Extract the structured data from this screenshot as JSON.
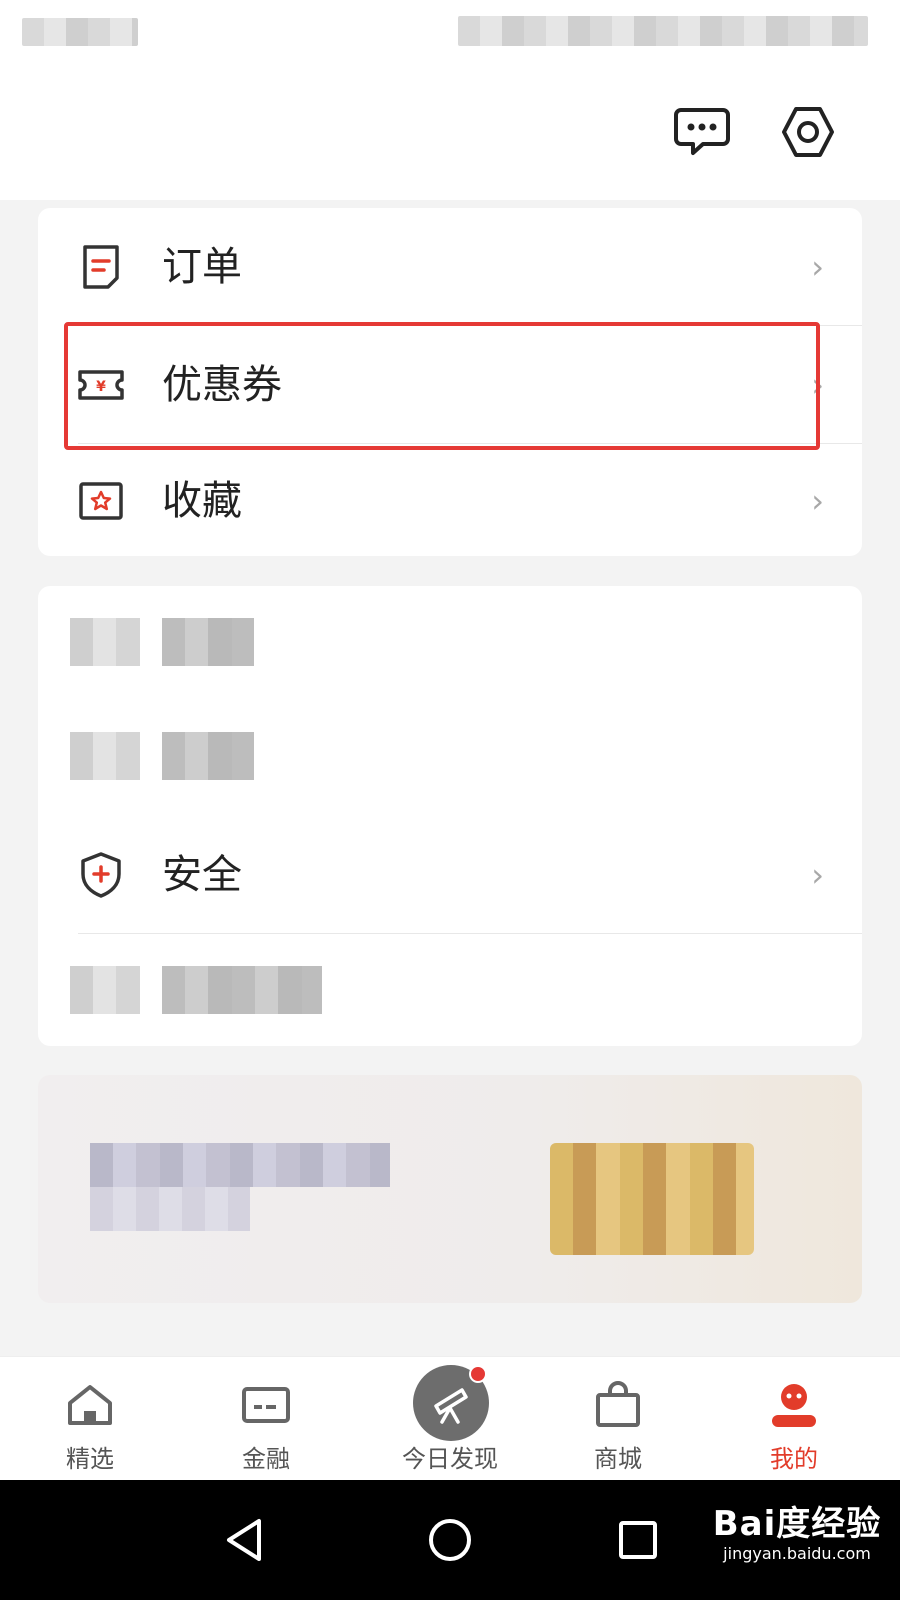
{
  "header": {
    "message_icon": "chat-bubble-icon",
    "settings_icon": "hexagon-gear-icon"
  },
  "menu_group_1": {
    "items": [
      {
        "label": "订单",
        "icon": "order-document-icon"
      },
      {
        "label": "优惠券",
        "icon": "coupon-ticket-icon",
        "currency_symbol": "¥"
      },
      {
        "label": "收藏",
        "icon": "favorite-star-icon"
      }
    ]
  },
  "menu_group_2": {
    "items": [
      {
        "label": "",
        "icon": "blurred-icon"
      },
      {
        "label": "",
        "icon": "blurred-icon"
      },
      {
        "label": "安全",
        "icon": "shield-plus-icon"
      },
      {
        "label": "",
        "icon": "blurred-icon"
      }
    ]
  },
  "chevron_glyph": "›",
  "tabbar": {
    "tabs": [
      {
        "label": "精选",
        "icon": "home-icon",
        "active": false
      },
      {
        "label": "金融",
        "icon": "card-icon",
        "active": false
      },
      {
        "label": "今日发现",
        "icon": "telescope-icon",
        "active": false,
        "badge": true
      },
      {
        "label": "商城",
        "icon": "shopping-bag-icon",
        "active": false
      },
      {
        "label": "我的",
        "icon": "profile-icon",
        "active": true
      }
    ]
  },
  "colors": {
    "accent": "#e23c2a",
    "highlight_box": "#e53935",
    "chevron": "#a8a8a8"
  },
  "system_nav": {
    "back_icon": "triangle-back-icon",
    "home_icon": "circle-home-icon",
    "recents_icon": "square-recents-icon"
  },
  "watermark": {
    "brand": "Bai度经验",
    "url": "jingyan.baidu.com"
  }
}
